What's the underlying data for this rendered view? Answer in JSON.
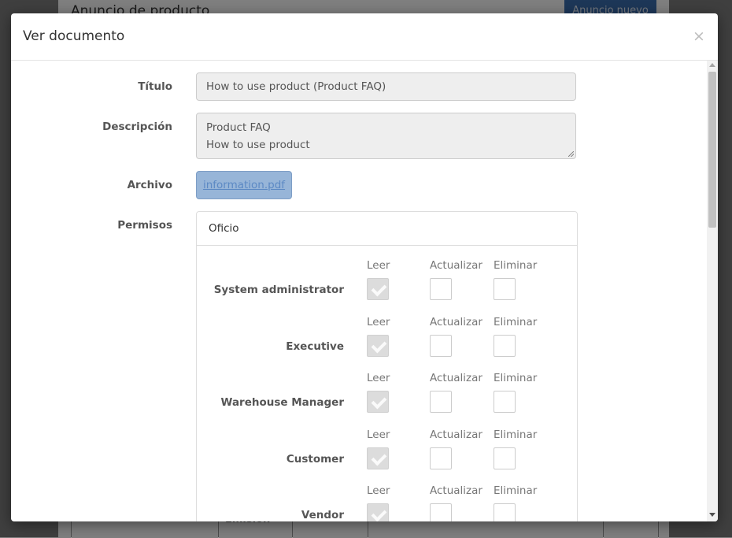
{
  "background": {
    "page_title": "Anuncio de producto",
    "new_button": "Anuncio nuevo",
    "table_header_partial": "Emisión"
  },
  "modal": {
    "title": "Ver documento",
    "close_glyph": "×",
    "fields": {
      "title_label": "Título",
      "title_value": "How to use product (Product FAQ)",
      "description_label": "Descripción",
      "description_lines": [
        "Product FAQ",
        "How to use product"
      ],
      "file_label": "Archivo",
      "file_name": "information.pdf",
      "permissions_label": "Permisos"
    },
    "permissions": {
      "panel_title": "Oficio",
      "column_labels": [
        "Leer",
        "Actualizar",
        "Eliminar"
      ],
      "roles": [
        {
          "name": "System administrator",
          "read": true,
          "update": false,
          "delete": false
        },
        {
          "name": "Executive",
          "read": true,
          "update": false,
          "delete": false
        },
        {
          "name": "Warehouse Manager",
          "read": true,
          "update": false,
          "delete": false
        },
        {
          "name": "Customer",
          "read": true,
          "update": false,
          "delete": false
        },
        {
          "name": "Vendor",
          "read": true,
          "update": false,
          "delete": false
        }
      ]
    }
  },
  "colors": {
    "backdrop": "#7f7f7f",
    "primary_button": "#3b6fb0",
    "file_button": "#97b5d8",
    "checked_box": "#dcdcdc"
  }
}
